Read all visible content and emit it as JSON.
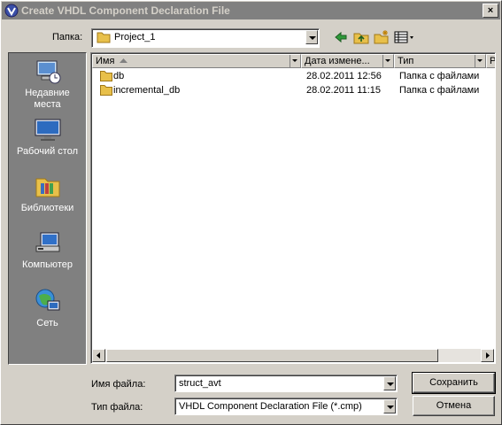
{
  "window": {
    "title": "Create VHDL Component Declaration File"
  },
  "toolbar": {
    "look_in_label": "Папка:",
    "look_in_value": "Project_1"
  },
  "places": [
    {
      "label": "Недавние места",
      "icon": "recent-places-icon"
    },
    {
      "label": "Рабочий стол",
      "icon": "desktop-icon"
    },
    {
      "label": "Библиотеки",
      "icon": "libraries-icon"
    },
    {
      "label": "Компьютер",
      "icon": "computer-icon"
    },
    {
      "label": "Сеть",
      "icon": "network-icon"
    }
  ],
  "columns": {
    "name": "Имя",
    "date": "Дата измене...",
    "type": "Тип",
    "extra": "Р"
  },
  "files": [
    {
      "name": "db",
      "date": "28.02.2011 12:56",
      "type": "Папка с файлами"
    },
    {
      "name": "incremental_db",
      "date": "28.02.2011 11:15",
      "type": "Папка с файлами"
    }
  ],
  "form": {
    "filename_label": "Имя файла:",
    "filename_value": "struct_avt",
    "filetype_label": "Тип файла:",
    "filetype_value": "VHDL Component Declaration File (*.cmp)"
  },
  "buttons": {
    "save": "Сохранить",
    "cancel": "Отмена"
  },
  "colors": {
    "title_bar_inactive": "#808080",
    "places_bar": "#808080",
    "face": "#d4d0c8",
    "folder": "#e8c04a"
  }
}
